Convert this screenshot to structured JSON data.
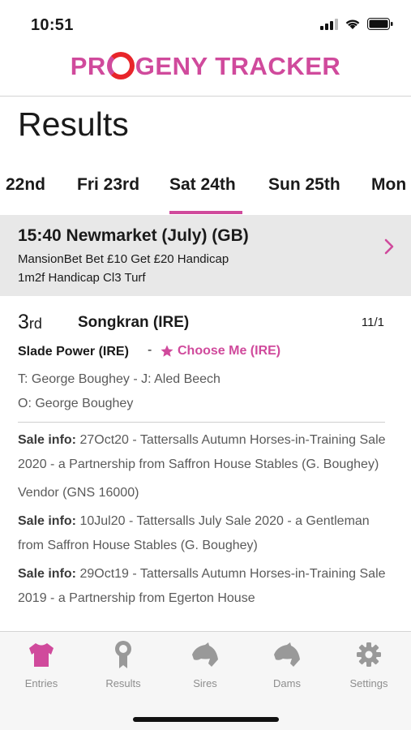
{
  "status_bar": {
    "time": "10:51"
  },
  "app": {
    "logo_pre": "PR",
    "logo_post": "GENY TRACKER",
    "brand_color": "#d04a9c"
  },
  "page": {
    "title": "Results"
  },
  "date_tabs": [
    {
      "label": "22nd"
    },
    {
      "label": "Fri 23rd"
    },
    {
      "label": "Sat 24th",
      "selected": true
    },
    {
      "label": "Sun 25th"
    },
    {
      "label": "Mon"
    }
  ],
  "race": {
    "title": "15:40 Newmarket (July) (GB)",
    "name": "MansionBet Bet £10 Get £20 Handicap",
    "details": "1m2f Handicap Cl3 Turf"
  },
  "result": {
    "position_number": "3",
    "position_suffix": "rd",
    "horse": "Songkran (IRE)",
    "odds": "11/1",
    "sire": "Slade Power (IRE)",
    "separator": "-",
    "dam": "Choose Me (IRE)",
    "trainer_jockey": "T: George Boughey - J: Aled Beech",
    "owner": "O: George Boughey",
    "sales": [
      {
        "label": "Sale info:",
        "text": " 27Oct20 - Tattersalls Autumn Horses-in-Training Sale 2020 - a Partnership from Saffron House Stables (G. Boughey)"
      },
      {
        "label": "",
        "text": "Vendor (GNS 16000)"
      },
      {
        "label": "Sale info:",
        "text": " 10Jul20 - Tattersalls July Sale 2020 - a Gentleman from Saffron House Stables (G. Boughey)"
      },
      {
        "label": "Sale info:",
        "text": " 29Oct19 - Tattersalls Autumn Horses-in-Training Sale 2019 - a Partnership from Egerton House"
      }
    ]
  },
  "tab_bar": [
    {
      "label": "Entries",
      "icon": "jockey-silks-icon",
      "active": true
    },
    {
      "label": "Results",
      "icon": "rosette-icon"
    },
    {
      "label": "Sires",
      "icon": "horse-head-icon"
    },
    {
      "label": "Dams",
      "icon": "horse-head-icon"
    },
    {
      "label": "Settings",
      "icon": "gear-icon"
    }
  ]
}
